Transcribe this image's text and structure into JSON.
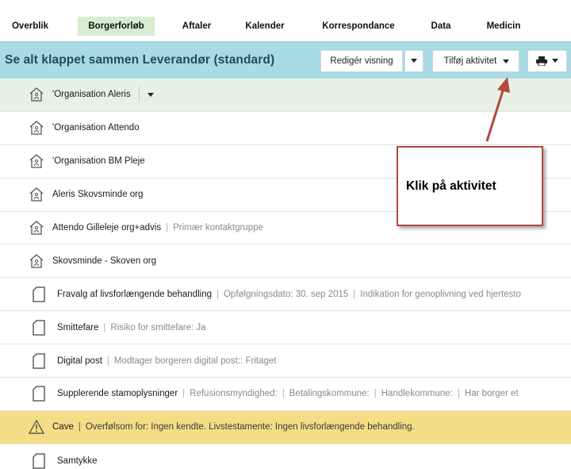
{
  "nav": {
    "tabs": [
      "Overblik",
      "Borgerforløb",
      "Aftaler",
      "Kalender",
      "Korrespondance",
      "Data",
      "Medicin"
    ]
  },
  "header": {
    "title": "Se alt klappet sammen Leverandør (standard)",
    "edit_view_label": "Redigér visning",
    "add_activity_label": "Tilføj aktivitet"
  },
  "rows": [
    {
      "title": "'Organisation Aleris",
      "meta": []
    },
    {
      "title": "'Organisation Attendo",
      "meta": []
    },
    {
      "title": "'Organisation BM Pleje",
      "meta": []
    },
    {
      "title": "Aleris Skovsminde org",
      "meta": []
    },
    {
      "title": "Attendo Gilleleje org+advis",
      "meta": [
        "Primær kontaktgruppe"
      ]
    },
    {
      "title": "Skovsminde - Skoven org",
      "meta": []
    },
    {
      "title": "Fravalg af livsforlængende behandling",
      "meta": [
        "Opfølgningsdato: 30. sep 2015",
        "Indikation for genoplivning ved hjertesto"
      ]
    },
    {
      "title": "Smittefare",
      "meta": [
        "Risiko for smittefare: Ja"
      ]
    },
    {
      "title": "Digital post",
      "meta": [
        "Modtager borgeren digital post:: Fritaget"
      ]
    },
    {
      "title": "Supplerende stamoplysninger",
      "meta": [
        "Refusionsmyndighed:",
        "Betalingskommune:",
        "Handlekommune:",
        "Har borger et"
      ]
    },
    {
      "title": "Cave",
      "meta": [
        "Overfølsom for: Ingen kendte. Livstestamente: Ingen livsforlængende behandling."
      ]
    },
    {
      "title": "Samtykke",
      "meta": []
    }
  ],
  "callout": {
    "text": "Klik på aktivitet"
  },
  "colors": {
    "header_bg": "#a8dbe4",
    "active_tab_bg": "#d8ecd2",
    "warn_row_bg": "#f4dd86",
    "callout_border": "#b4493b"
  },
  "icons": {
    "organisation": "house-icon",
    "document": "document-icon",
    "warning": "warning-icon",
    "print": "printer-icon"
  }
}
